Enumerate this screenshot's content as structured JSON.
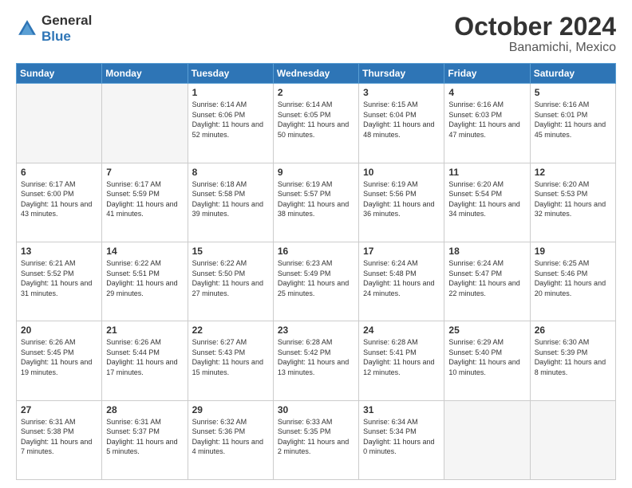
{
  "header": {
    "logo_line1": "General",
    "logo_line2": "Blue",
    "month": "October 2024",
    "location": "Banamichi, Mexico"
  },
  "weekdays": [
    "Sunday",
    "Monday",
    "Tuesday",
    "Wednesday",
    "Thursday",
    "Friday",
    "Saturday"
  ],
  "rows": [
    [
      {
        "day": "",
        "empty": true
      },
      {
        "day": "",
        "empty": true
      },
      {
        "day": "1",
        "sunrise": "6:14 AM",
        "sunset": "6:06 PM",
        "daylight": "11 hours and 52 minutes."
      },
      {
        "day": "2",
        "sunrise": "6:14 AM",
        "sunset": "6:05 PM",
        "daylight": "11 hours and 50 minutes."
      },
      {
        "day": "3",
        "sunrise": "6:15 AM",
        "sunset": "6:04 PM",
        "daylight": "11 hours and 48 minutes."
      },
      {
        "day": "4",
        "sunrise": "6:16 AM",
        "sunset": "6:03 PM",
        "daylight": "11 hours and 47 minutes."
      },
      {
        "day": "5",
        "sunrise": "6:16 AM",
        "sunset": "6:01 PM",
        "daylight": "11 hours and 45 minutes."
      }
    ],
    [
      {
        "day": "6",
        "sunrise": "6:17 AM",
        "sunset": "6:00 PM",
        "daylight": "11 hours and 43 minutes."
      },
      {
        "day": "7",
        "sunrise": "6:17 AM",
        "sunset": "5:59 PM",
        "daylight": "11 hours and 41 minutes."
      },
      {
        "day": "8",
        "sunrise": "6:18 AM",
        "sunset": "5:58 PM",
        "daylight": "11 hours and 39 minutes."
      },
      {
        "day": "9",
        "sunrise": "6:19 AM",
        "sunset": "5:57 PM",
        "daylight": "11 hours and 38 minutes."
      },
      {
        "day": "10",
        "sunrise": "6:19 AM",
        "sunset": "5:56 PM",
        "daylight": "11 hours and 36 minutes."
      },
      {
        "day": "11",
        "sunrise": "6:20 AM",
        "sunset": "5:54 PM",
        "daylight": "11 hours and 34 minutes."
      },
      {
        "day": "12",
        "sunrise": "6:20 AM",
        "sunset": "5:53 PM",
        "daylight": "11 hours and 32 minutes."
      }
    ],
    [
      {
        "day": "13",
        "sunrise": "6:21 AM",
        "sunset": "5:52 PM",
        "daylight": "11 hours and 31 minutes."
      },
      {
        "day": "14",
        "sunrise": "6:22 AM",
        "sunset": "5:51 PM",
        "daylight": "11 hours and 29 minutes."
      },
      {
        "day": "15",
        "sunrise": "6:22 AM",
        "sunset": "5:50 PM",
        "daylight": "11 hours and 27 minutes."
      },
      {
        "day": "16",
        "sunrise": "6:23 AM",
        "sunset": "5:49 PM",
        "daylight": "11 hours and 25 minutes."
      },
      {
        "day": "17",
        "sunrise": "6:24 AM",
        "sunset": "5:48 PM",
        "daylight": "11 hours and 24 minutes."
      },
      {
        "day": "18",
        "sunrise": "6:24 AM",
        "sunset": "5:47 PM",
        "daylight": "11 hours and 22 minutes."
      },
      {
        "day": "19",
        "sunrise": "6:25 AM",
        "sunset": "5:46 PM",
        "daylight": "11 hours and 20 minutes."
      }
    ],
    [
      {
        "day": "20",
        "sunrise": "6:26 AM",
        "sunset": "5:45 PM",
        "daylight": "11 hours and 19 minutes."
      },
      {
        "day": "21",
        "sunrise": "6:26 AM",
        "sunset": "5:44 PM",
        "daylight": "11 hours and 17 minutes."
      },
      {
        "day": "22",
        "sunrise": "6:27 AM",
        "sunset": "5:43 PM",
        "daylight": "11 hours and 15 minutes."
      },
      {
        "day": "23",
        "sunrise": "6:28 AM",
        "sunset": "5:42 PM",
        "daylight": "11 hours and 13 minutes."
      },
      {
        "day": "24",
        "sunrise": "6:28 AM",
        "sunset": "5:41 PM",
        "daylight": "11 hours and 12 minutes."
      },
      {
        "day": "25",
        "sunrise": "6:29 AM",
        "sunset": "5:40 PM",
        "daylight": "11 hours and 10 minutes."
      },
      {
        "day": "26",
        "sunrise": "6:30 AM",
        "sunset": "5:39 PM",
        "daylight": "11 hours and 8 minutes."
      }
    ],
    [
      {
        "day": "27",
        "sunrise": "6:31 AM",
        "sunset": "5:38 PM",
        "daylight": "11 hours and 7 minutes."
      },
      {
        "day": "28",
        "sunrise": "6:31 AM",
        "sunset": "5:37 PM",
        "daylight": "11 hours and 5 minutes."
      },
      {
        "day": "29",
        "sunrise": "6:32 AM",
        "sunset": "5:36 PM",
        "daylight": "11 hours and 4 minutes."
      },
      {
        "day": "30",
        "sunrise": "6:33 AM",
        "sunset": "5:35 PM",
        "daylight": "11 hours and 2 minutes."
      },
      {
        "day": "31",
        "sunrise": "6:34 AM",
        "sunset": "5:34 PM",
        "daylight": "11 hours and 0 minutes."
      },
      {
        "day": "",
        "empty": true
      },
      {
        "day": "",
        "empty": true
      }
    ]
  ]
}
